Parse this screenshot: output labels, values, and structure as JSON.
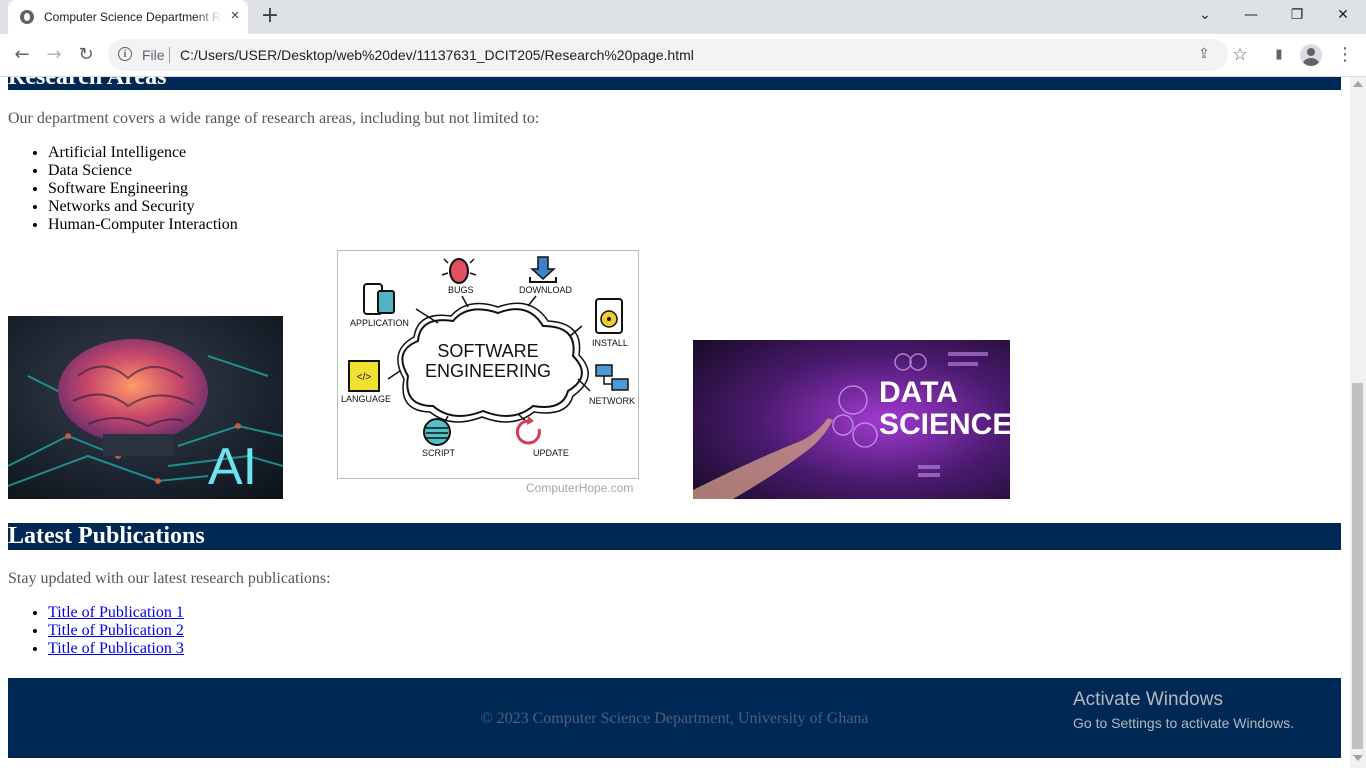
{
  "browser": {
    "tab_title": "Computer Science Department Research",
    "tab_close": "×",
    "new_tab": "+",
    "window_controls": {
      "dropdown": "⌄",
      "minimize": "—",
      "restore": "❐",
      "close": "✕"
    },
    "nav": {
      "back": "←",
      "forward": "→",
      "reload": "↻"
    },
    "address": {
      "info": "i",
      "scheme": "File",
      "url": "C:/Users/USER/Desktop/web%20dev/11137631_DCIT205/Research%20page.html"
    },
    "toolbar_icons": {
      "share": "⇪",
      "bookmark": "☆",
      "sidepanel": "▮",
      "menu": "⋮"
    }
  },
  "page": {
    "research_areas": {
      "heading": "Research Areas",
      "intro": "Our department covers a wide range of research areas, including but not limited to:",
      "items": [
        "Artificial Intelligence",
        "Data Science",
        "Software Engineering",
        "Networks and Security",
        "Human-Computer Interaction"
      ],
      "images": {
        "ai": {
          "label": "AI"
        },
        "software_engineering": {
          "center_line1": "SOFTWARE",
          "center_line2": "ENGINEERING",
          "labels": {
            "bugs": "BUGS",
            "download": "DOWNLOAD",
            "application": "APPLICATION",
            "install": "INSTALL",
            "language": "LANGUAGE",
            "network": "NETWORK",
            "script": "SCRIPT",
            "update": "UPDATE"
          },
          "credit": "ComputerHope.com"
        },
        "data_science": {
          "line1": "DATA",
          "line2": "SCIENCE"
        }
      }
    },
    "publications": {
      "heading": "Latest Publications",
      "intro": "Stay updated with our latest research publications:",
      "items": [
        "Title of Publication 1",
        "Title of Publication 2",
        "Title of Publication 3"
      ]
    },
    "footer": {
      "text": "© 2023 Computer Science Department, University of Ghana"
    }
  },
  "os_overlay": {
    "activate_title": "Activate Windows",
    "activate_sub": "Go to Settings to activate Windows."
  },
  "colors": {
    "section_bar": "#002855",
    "link": "#0000ee",
    "chrome_tabstrip": "#dee1e6"
  }
}
